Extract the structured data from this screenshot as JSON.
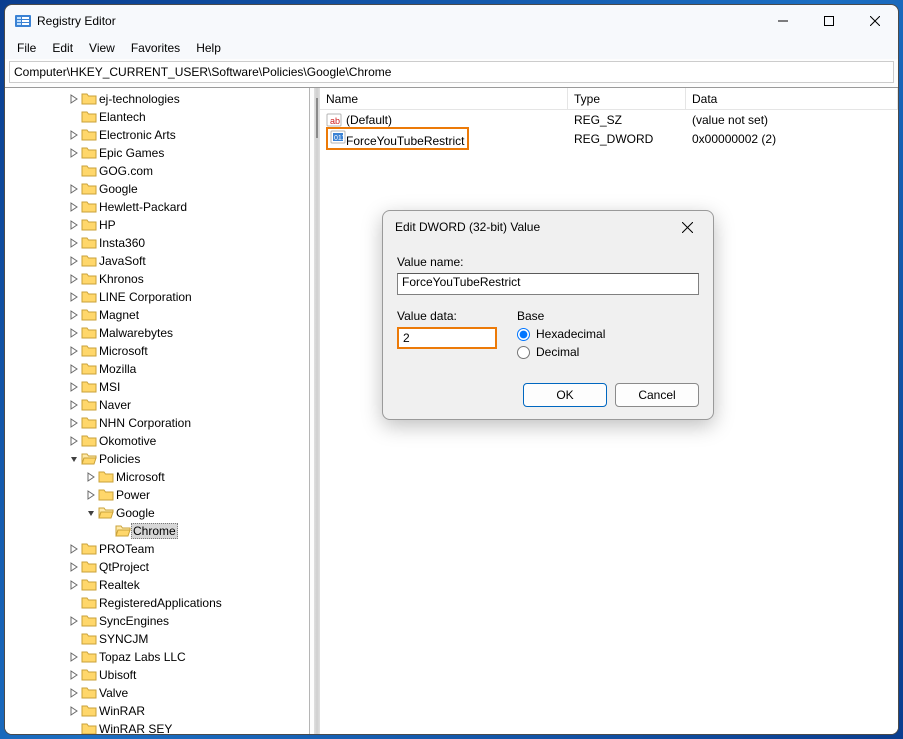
{
  "window": {
    "title": "Registry Editor",
    "minimize_tooltip": "Minimize",
    "maximize_tooltip": "Maximize",
    "close_tooltip": "Close"
  },
  "menubar": {
    "file": "File",
    "edit": "Edit",
    "view": "View",
    "favorites": "Favorites",
    "help": "Help"
  },
  "addressbar": {
    "path": "Computer\\HKEY_CURRENT_USER\\Software\\Policies\\Google\\Chrome"
  },
  "tree": {
    "indent_base": 62,
    "indent_step": 17,
    "items": [
      {
        "depth": 0,
        "label": "ej-technologies",
        "expander": ">"
      },
      {
        "depth": 0,
        "label": "Elantech",
        "expander": ""
      },
      {
        "depth": 0,
        "label": "Electronic Arts",
        "expander": ">"
      },
      {
        "depth": 0,
        "label": "Epic Games",
        "expander": ">"
      },
      {
        "depth": 0,
        "label": "GOG.com",
        "expander": ""
      },
      {
        "depth": 0,
        "label": "Google",
        "expander": ">"
      },
      {
        "depth": 0,
        "label": "Hewlett-Packard",
        "expander": ">"
      },
      {
        "depth": 0,
        "label": "HP",
        "expander": ">"
      },
      {
        "depth": 0,
        "label": "Insta360",
        "expander": ">"
      },
      {
        "depth": 0,
        "label": "JavaSoft",
        "expander": ">"
      },
      {
        "depth": 0,
        "label": "Khronos",
        "expander": ">"
      },
      {
        "depth": 0,
        "label": "LINE Corporation",
        "expander": ">"
      },
      {
        "depth": 0,
        "label": "Magnet",
        "expander": ">"
      },
      {
        "depth": 0,
        "label": "Malwarebytes",
        "expander": ">"
      },
      {
        "depth": 0,
        "label": "Microsoft",
        "expander": ">"
      },
      {
        "depth": 0,
        "label": "Mozilla",
        "expander": ">"
      },
      {
        "depth": 0,
        "label": "MSI",
        "expander": ">"
      },
      {
        "depth": 0,
        "label": "Naver",
        "expander": ">"
      },
      {
        "depth": 0,
        "label": "NHN Corporation",
        "expander": ">"
      },
      {
        "depth": 0,
        "label": "Okomotive",
        "expander": ">"
      },
      {
        "depth": 0,
        "label": "Policies",
        "expander": "v"
      },
      {
        "depth": 1,
        "label": "Microsoft",
        "expander": ">"
      },
      {
        "depth": 1,
        "label": "Power",
        "expander": ">"
      },
      {
        "depth": 1,
        "label": "Google",
        "expander": "v"
      },
      {
        "depth": 2,
        "label": "Chrome",
        "expander": "",
        "selected": true
      },
      {
        "depth": 0,
        "label": "PROTeam",
        "expander": ">"
      },
      {
        "depth": 0,
        "label": "QtProject",
        "expander": ">"
      },
      {
        "depth": 0,
        "label": "Realtek",
        "expander": ">"
      },
      {
        "depth": 0,
        "label": "RegisteredApplications",
        "expander": ""
      },
      {
        "depth": 0,
        "label": "SyncEngines",
        "expander": ">"
      },
      {
        "depth": 0,
        "label": "SYNCJM",
        "expander": ""
      },
      {
        "depth": 0,
        "label": "Topaz Labs LLC",
        "expander": ">"
      },
      {
        "depth": 0,
        "label": "Ubisoft",
        "expander": ">"
      },
      {
        "depth": 0,
        "label": "Valve",
        "expander": ">"
      },
      {
        "depth": 0,
        "label": "WinRAR",
        "expander": ">"
      },
      {
        "depth": 0,
        "label": "WinRAR SEY",
        "expander": ""
      }
    ]
  },
  "list": {
    "columns": {
      "name": "Name",
      "type": "Type",
      "data": "Data"
    },
    "rows": [
      {
        "name": "(Default)",
        "type": "REG_SZ",
        "data": "(value not set)",
        "icon": "str"
      },
      {
        "name": "ForceYouTubeRestrict",
        "type": "REG_DWORD",
        "data": "0x00000002 (2)",
        "icon": "dword",
        "highlighted": true
      }
    ]
  },
  "dialog": {
    "title": "Edit DWORD (32-bit) Value",
    "value_name_label": "Value name:",
    "value_name": "ForceYouTubeRestrict",
    "value_data_label": "Value data:",
    "value_data": "2",
    "base_label": "Base",
    "hex_label": "Hexadecimal",
    "dec_label": "Decimal",
    "base_selected": "hex",
    "ok": "OK",
    "cancel": "Cancel"
  }
}
